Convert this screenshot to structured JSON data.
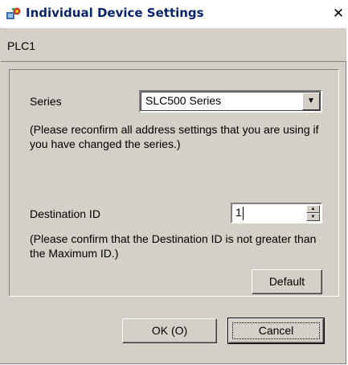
{
  "window": {
    "title": "Individual Device Settings",
    "close_label": "✕"
  },
  "device": {
    "name": "PLC1"
  },
  "series": {
    "label": "Series",
    "selected": "SLC500 Series",
    "note": "(Please reconfirm all address settings that you are using if you have changed the series.)"
  },
  "destination": {
    "label": "Destination ID",
    "value": "1",
    "note": "(Please confirm that the Destination ID is not greater than the Maximum ID.)"
  },
  "buttons": {
    "default": "Default",
    "ok": "OK (O)",
    "cancel": "Cancel"
  },
  "icons": {
    "title_icon": "app-settings-icon",
    "dropdown": "chevron-down-icon",
    "spin_up": "spin-up-icon",
    "spin_down": "spin-down-icon"
  }
}
